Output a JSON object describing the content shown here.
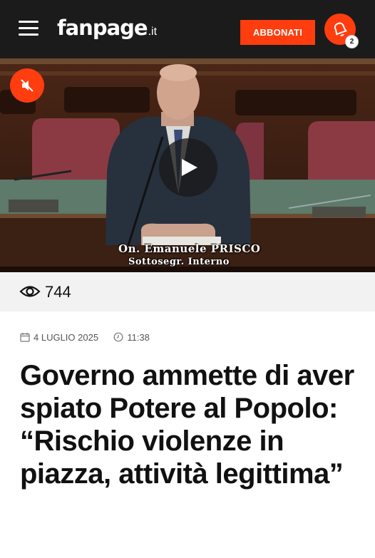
{
  "header": {
    "logo_main": "fanpage",
    "logo_tld": ".it",
    "subscribe_label": "ABBONATI",
    "notification_count": "2"
  },
  "video": {
    "caption_line1": "On. Emanuele PRISCO",
    "caption_line2": "Sottosegr. Interno"
  },
  "stats": {
    "views": "744"
  },
  "article": {
    "date": "4 LUGLIO 2025",
    "time": "11:38",
    "title": "Governo ammette di aver spiato Potere al Popolo: “Rischio violenze in piazza, attività legittima”"
  },
  "colors": {
    "accent": "#ff3d0f",
    "header_bg": "#1b1b1b"
  },
  "icons": [
    "menu-icon",
    "bell-icon",
    "mute-icon",
    "play-icon",
    "eye-icon",
    "calendar-icon",
    "clock-icon"
  ]
}
